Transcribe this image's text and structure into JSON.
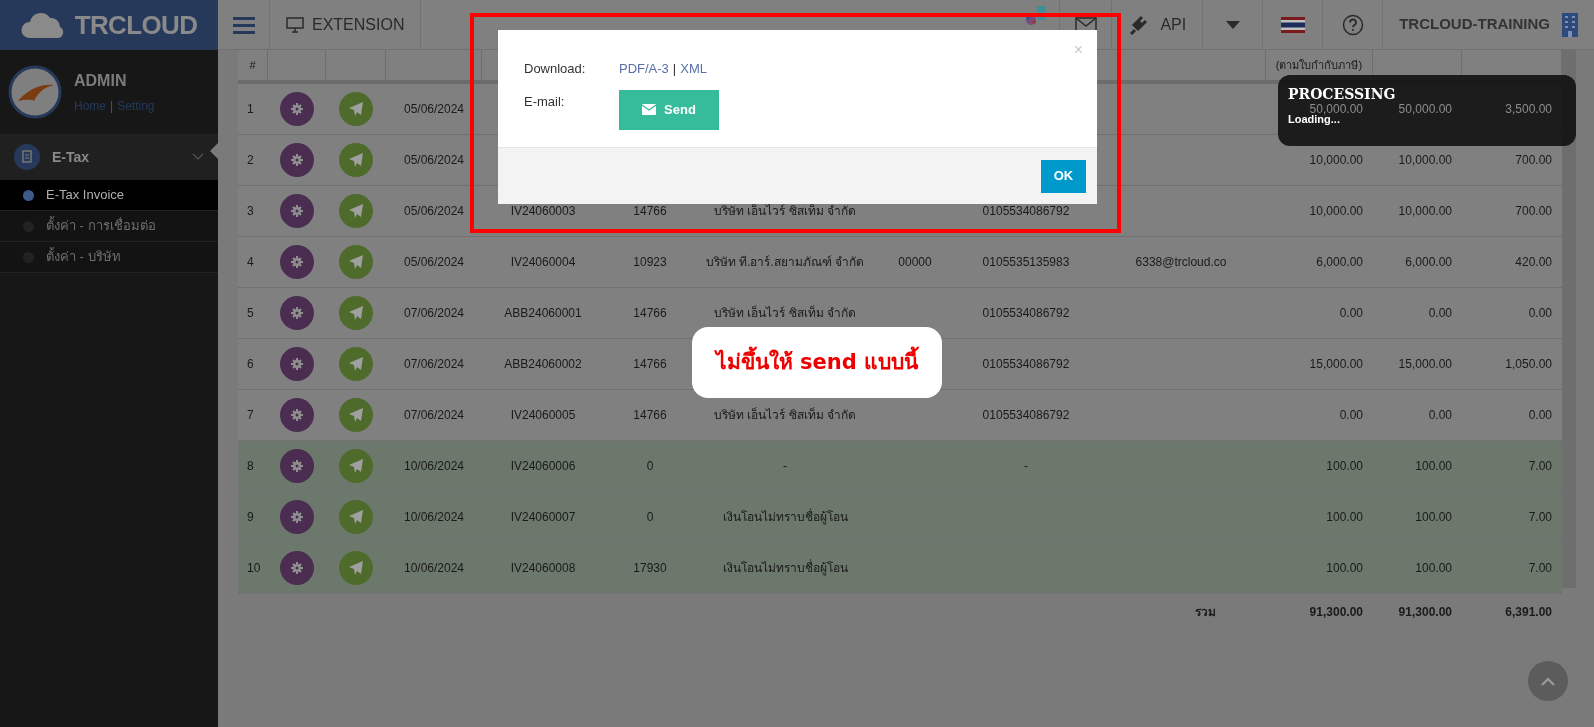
{
  "topbar": {
    "logo": "TRCLOUD",
    "extension": "EXTENSION",
    "api": "API",
    "company": "TRCLOUD-TRAINING"
  },
  "sidebar": {
    "user": "ADMIN",
    "links": [
      "Home",
      "Setting"
    ],
    "link_separator": "|",
    "menu": [
      {
        "label": "E-Tax",
        "expanded": true,
        "children": [
          {
            "label": "E-Tax Invoice",
            "selected": true
          },
          {
            "label": "ตั้งค่า - การเชื่อมต่อ",
            "selected": false
          },
          {
            "label": "ตั้งค่า - บริษัท",
            "selected": false
          }
        ]
      }
    ]
  },
  "table": {
    "headers": {
      "no": "#",
      "amount": "(ตามใบกำกับภาษี)"
    },
    "rows": [
      {
        "no": "1",
        "date": "05/06/2024",
        "amount": "50,000.00",
        "base": "50,000.00",
        "vat": "3,500.00",
        "highlighted": false
      },
      {
        "no": "2",
        "date": "05/06/2024",
        "amount": "10,000.00",
        "base": "10,000.00",
        "vat": "700.00",
        "highlighted": false
      },
      {
        "no": "3",
        "date": "05/06/2024",
        "doc": "IV24060003",
        "code": "14766",
        "customer": "บริษัท เอ็นไวร์ ซิสเท็ม จำกัด",
        "tax_id": "0105534086792",
        "amount": "10,000.00",
        "base": "10,000.00",
        "vat": "700.00",
        "highlighted": false
      },
      {
        "no": "4",
        "date": "05/06/2024",
        "doc": "IV24060004",
        "code": "10923",
        "customer": "บริษัท ที.อาร์.สยามภัณฑ์ จำกัด",
        "branch": "00000",
        "tax_id": "0105535135983",
        "email": "6338@trcloud.co",
        "amount": "6,000.00",
        "base": "6,000.00",
        "vat": "420.00",
        "highlighted": false
      },
      {
        "no": "5",
        "date": "07/06/2024",
        "doc": "ABB24060001",
        "code": "14766",
        "customer": "บริษัท เอ็นไวร์ ซิสเท็ม จำกัด",
        "tax_id": "0105534086792",
        "amount": "0.00",
        "base": "0.00",
        "vat": "0.00",
        "highlighted": false
      },
      {
        "no": "6",
        "date": "07/06/2024",
        "doc": "ABB24060002",
        "code": "14766",
        "tax_id": "0105534086792",
        "amount": "15,000.00",
        "base": "15,000.00",
        "vat": "1,050.00",
        "highlighted": false
      },
      {
        "no": "7",
        "date": "07/06/2024",
        "doc": "IV24060005",
        "code": "14766",
        "customer": "บริษัท เอ็นไวร์ ซิสเท็ม จำกัด",
        "tax_id": "0105534086792",
        "amount": "0.00",
        "base": "0.00",
        "vat": "0.00",
        "highlighted": false
      },
      {
        "no": "8",
        "date": "10/06/2024",
        "doc": "IV24060006",
        "code": "0",
        "customer": "-",
        "tax_id": "-",
        "amount": "100.00",
        "base": "100.00",
        "vat": "7.00",
        "highlighted": true
      },
      {
        "no": "9",
        "date": "10/06/2024",
        "doc": "IV24060007",
        "code": "0",
        "customer": "เงินโอนไม่ทราบชื่อผู้โอน",
        "amount": "100.00",
        "base": "100.00",
        "vat": "7.00",
        "highlighted": true
      },
      {
        "no": "10",
        "date": "10/06/2024",
        "doc": "IV24060008",
        "code": "17930",
        "customer": "เงินโอนไม่ทราบชื่อผู้โอน",
        "amount": "100.00",
        "base": "100.00",
        "vat": "7.00",
        "highlighted": true
      }
    ],
    "total": {
      "label": "รวม",
      "amount": "91,300.00",
      "base": "91,300.00",
      "vat": "6,391.00"
    }
  },
  "modal": {
    "download_label": "Download:",
    "links": [
      "PDF/A-3",
      "XML"
    ],
    "link_separator": "|",
    "email_label": "E-mail:",
    "send_button": "Send",
    "close": "×",
    "ok_button": "OK"
  },
  "callout": {
    "text": "ไม่ขึ้นให้ send แบบนี้"
  },
  "toast": {
    "title": "PROCESSING",
    "message": "Loading..."
  }
}
